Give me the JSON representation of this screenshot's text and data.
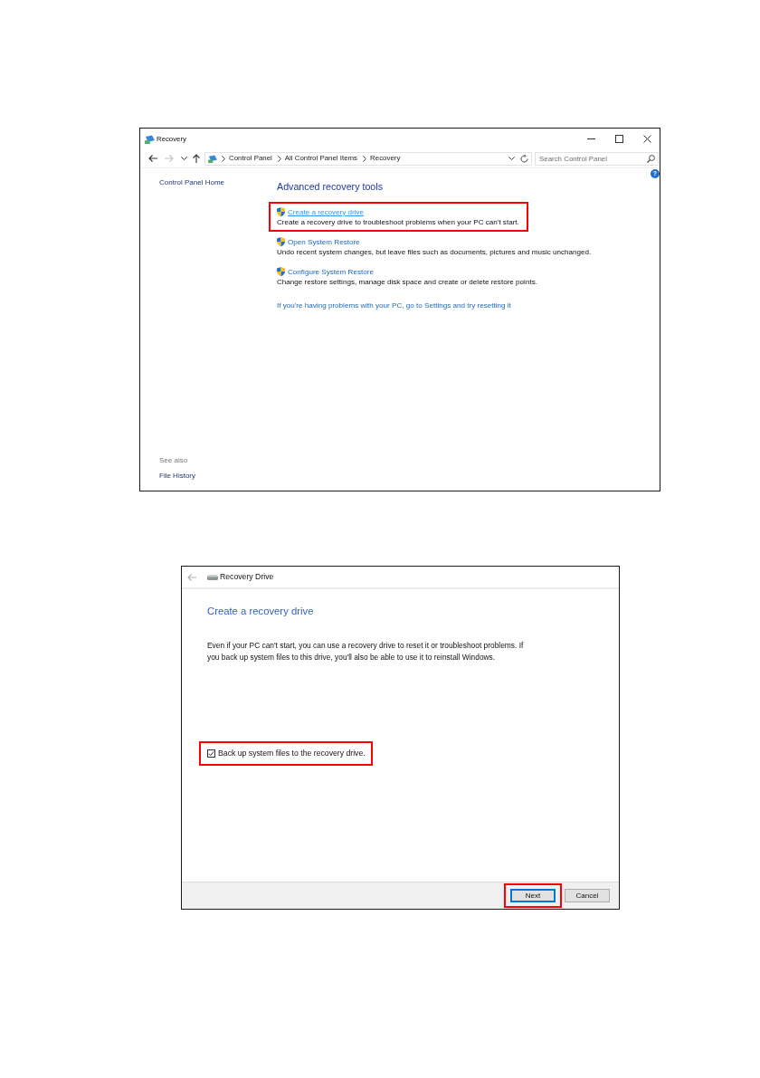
{
  "recovery_window": {
    "title": "Recovery",
    "nav_buttons": [
      {
        "kind": "back",
        "disabled": false
      },
      {
        "kind": "forward",
        "disabled": true
      },
      {
        "kind": "recent",
        "disabled": false
      },
      {
        "kind": "up",
        "disabled": false
      }
    ],
    "breadcrumb": [
      "Control Panel",
      "All Control Panel Items",
      "Recovery"
    ],
    "search": {
      "placeholder": "Search Control Panel"
    },
    "help_button": "?",
    "sidebar": {
      "home_link": "Control Panel Home",
      "see_also_heading": "See also",
      "see_also_links": [
        "File History"
      ]
    },
    "heading": "Advanced recovery tools",
    "tools": [
      {
        "link": "Create a recovery drive",
        "description": "Create a recovery drive to troubleshoot problems when your PC can't start.",
        "hovered": true,
        "highlighted": true
      },
      {
        "link": "Open System Restore",
        "description": "Undo recent system changes, but leave files such as documents, pictures and music unchanged.",
        "hovered": false,
        "highlighted": false
      },
      {
        "link": "Configure System Restore",
        "description": "Change restore settings, manage disk space and create or delete restore points.",
        "hovered": false,
        "highlighted": false
      }
    ],
    "reset_link": "If you're having problems with your PC, go to Settings and try resetting it"
  },
  "wizard_window": {
    "title": "Recovery Drive",
    "back_button": {
      "disabled": true
    },
    "heading": "Create a recovery drive",
    "body": "Even if your PC can't start, you can use a recovery drive to reset it or troubleshoot problems. If you back up system files to this drive, you'll also be able to use it to reinstall Windows.",
    "checkbox": {
      "label": "Back up system files to the recovery drive.",
      "checked": true,
      "highlighted": true
    },
    "buttons": [
      {
        "label": "Next",
        "default": true,
        "highlighted": true
      },
      {
        "label": "Cancel",
        "default": false,
        "highlighted": false
      }
    ]
  }
}
